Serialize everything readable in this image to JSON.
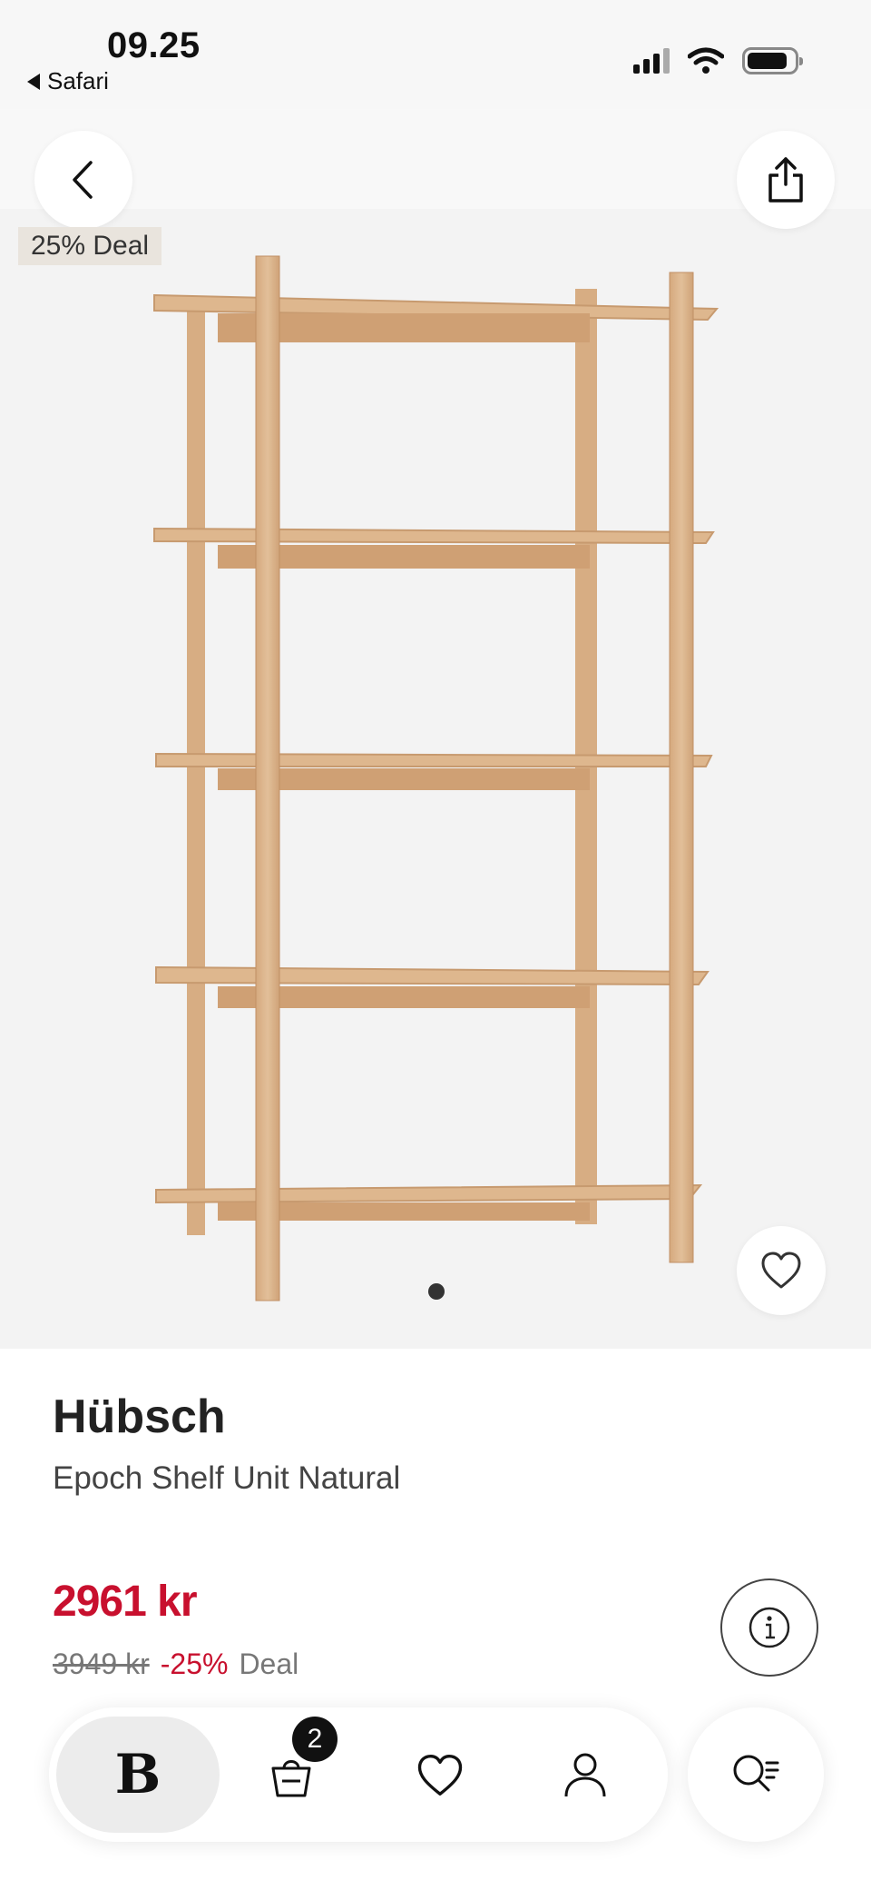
{
  "status_bar": {
    "time": "09.25",
    "back_app": "Safari",
    "icons": [
      "cellular-signal-icon",
      "wifi-icon",
      "battery-icon"
    ]
  },
  "gallery": {
    "deal_badge": "25% Deal",
    "current_image": 1,
    "total_images": 1,
    "icons": [
      "chevron-left-icon",
      "share-icon",
      "heart-icon"
    ]
  },
  "product": {
    "brand": "Hübsch",
    "name": "Epoch Shelf Unit Natural",
    "price": "2961 kr",
    "old_price": "3949 kr",
    "discount": "-25%",
    "deal_label": "Deal",
    "info_icon": "info-icon"
  },
  "nav": {
    "home_logo": "B",
    "cart_count": "2",
    "icons": [
      "cart-icon",
      "heart-icon",
      "user-icon",
      "search-icon"
    ]
  },
  "colors": {
    "price_red": "#c8102e",
    "wood": "#dcb48a",
    "hero_bg": "#f3f3f3"
  }
}
